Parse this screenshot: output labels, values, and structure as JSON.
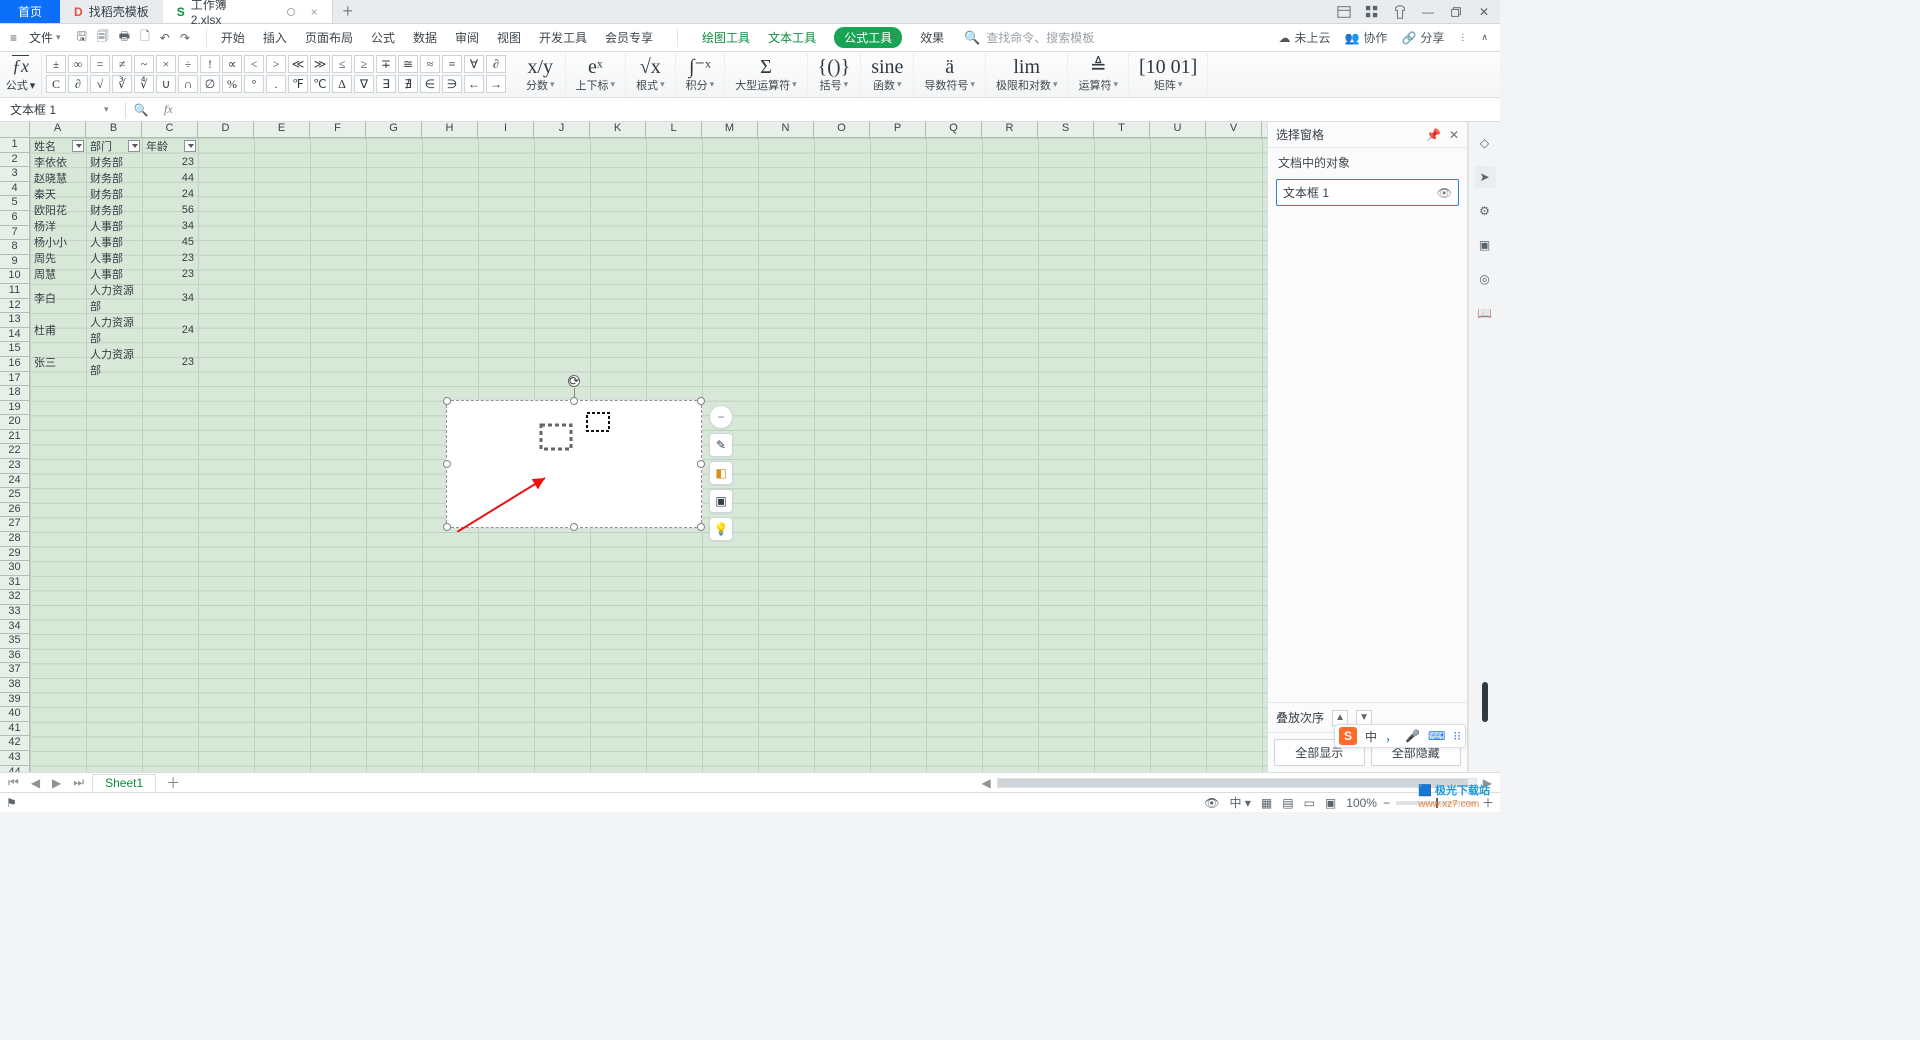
{
  "titlebar": {
    "home": "首页",
    "template_tab": "找稻壳模板",
    "file_tab": "工作簿2.xlsx",
    "win_icons": [
      "layout-icon",
      "grid-icon",
      "skin-icon",
      "minimize-icon",
      "restore-icon",
      "close-icon"
    ]
  },
  "menubar": {
    "file_label": "文件",
    "qat_icons": [
      "save-icon",
      "save-as-icon",
      "print-icon",
      "print-preview-icon",
      "undo-icon",
      "redo-icon"
    ],
    "tabs": [
      "开始",
      "插入",
      "页面布局",
      "公式",
      "数据",
      "审阅",
      "视图",
      "开发工具",
      "会员专享"
    ],
    "tool_tabs": {
      "draw": "绘图工具",
      "text": "文本工具",
      "formula": "公式工具",
      "effect": "效果"
    },
    "search_placeholder": "查找命令、搜索模板",
    "right": {
      "cloud": "未上云",
      "collab": "协作",
      "share": "分享"
    }
  },
  "formula": {
    "fx_label": "公式",
    "symbols_row1": [
      "±",
      "∞",
      "=",
      "≠",
      "~",
      "×",
      "÷",
      "!",
      "∝",
      "<",
      ">",
      "≪",
      "≫",
      "≤",
      "≥",
      "∓",
      "≅",
      "≈",
      "≡",
      "∀",
      "∂"
    ],
    "symbols_row2": [
      "C",
      "∂",
      "√",
      "∛",
      "∜",
      "∪",
      "∩",
      "∅",
      "%",
      "°",
      ".",
      "℉",
      "℃",
      "∆",
      "∇",
      "∃",
      "∄",
      "∈",
      "∋",
      "←",
      "→"
    ],
    "groups": [
      {
        "big": "x/y",
        "label": "分数"
      },
      {
        "big": "eˣ",
        "label": "上下标"
      },
      {
        "big": "√x",
        "label": "根式"
      },
      {
        "big": "∫⁻ˣ",
        "label": "积分"
      },
      {
        "big": "Σ",
        "label": "大型运算符"
      },
      {
        "big": "{()}",
        "label": "括号"
      },
      {
        "big": "sine",
        "label": "函数"
      },
      {
        "big": "ä",
        "label": "导数符号"
      },
      {
        "big": "lim",
        "label": "极限和对数"
      },
      {
        "big": "≜",
        "label": "运算符"
      },
      {
        "big": "[10\n01]",
        "label": "矩阵"
      }
    ]
  },
  "fxrow": {
    "name": "文本框 1"
  },
  "sheet": {
    "cols": [
      "A",
      "B",
      "C",
      "D",
      "E",
      "F",
      "G",
      "H",
      "I",
      "J",
      "K",
      "L",
      "M",
      "N",
      "O",
      "P",
      "Q",
      "R",
      "S",
      "T",
      "U",
      "V"
    ],
    "row_count": 44,
    "headers": [
      "姓名",
      "部门",
      "年龄"
    ],
    "rows": [
      [
        "李依依",
        "财务部",
        "23"
      ],
      [
        "赵晓慧",
        "财务部",
        "44"
      ],
      [
        "秦天",
        "财务部",
        "24"
      ],
      [
        "欧阳花",
        "财务部",
        "56"
      ],
      [
        "杨洋",
        "人事部",
        "34"
      ],
      [
        "杨小小",
        "人事部",
        "45"
      ],
      [
        "周先",
        "人事部",
        "23"
      ],
      [
        "周慧",
        "人事部",
        "23"
      ],
      [
        "李白",
        "人力资源部",
        "34"
      ],
      [
        "杜甫",
        "人力资源部",
        "24"
      ],
      [
        "张三",
        "人力资源部",
        "23"
      ]
    ]
  },
  "shape_tools": [
    "minus-icon",
    "eyedropper-icon",
    "fill-icon",
    "border-icon",
    "bulb-icon"
  ],
  "selpane": {
    "title": "选择窗格",
    "subtitle": "文档中的对象",
    "object": "文本框 1",
    "order_label": "叠放次序",
    "show_all": "全部显示",
    "hide_all": "全部隐藏"
  },
  "vstrip_icons": [
    "cursor-icon",
    "sliders-icon",
    "layout-pane-icon",
    "target-icon",
    "book-icon"
  ],
  "sheettabs": {
    "sheet1": "Sheet1"
  },
  "status": {
    "view_icons": [
      "eye-icon",
      "lang-icon",
      "normal-view-icon",
      "page-layout-icon",
      "page-break-icon",
      "reading-icon"
    ],
    "zoom": "100%"
  },
  "ime": {
    "lang": "中",
    "punct": "，",
    "voice": "🎤",
    "kbd": "⌨",
    "more": "⁝⁝"
  },
  "watermark": {
    "line1": "极光下载站",
    "line2": "www.xz7.com"
  }
}
